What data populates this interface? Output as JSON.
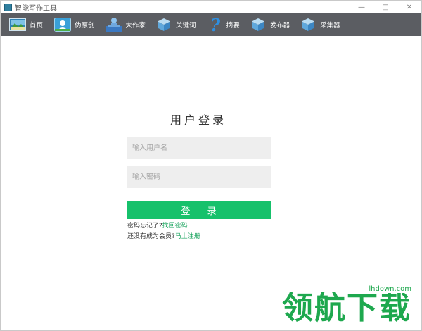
{
  "window": {
    "title": "智能写作工具",
    "controls": [
      "—",
      "□",
      "✕"
    ]
  },
  "toolbar": {
    "items": [
      {
        "label": "首页",
        "icon": "home-landscape-icon"
      },
      {
        "label": "伪原创",
        "icon": "user-card-icon"
      },
      {
        "label": "大作家",
        "icon": "writer-books-icon"
      },
      {
        "label": "关键词",
        "icon": "cube-icon"
      },
      {
        "label": "摘要",
        "icon": "question-mark-icon"
      },
      {
        "label": "发布器",
        "icon": "cube-icon"
      },
      {
        "label": "采集器",
        "icon": "cube-icon"
      }
    ]
  },
  "login": {
    "title": "用户登录",
    "username_placeholder": "输入用户名",
    "password_placeholder": "输入密码",
    "submit_label": "登 录",
    "forgot_text": "密码忘记了?",
    "forgot_link": "找回密码",
    "register_text": "还没有成为会员?",
    "register_link": "马上注册"
  },
  "watermark": {
    "text": "领航下载",
    "domain": "lhdown.com"
  },
  "colors": {
    "toolbar_bg": "#5b5d62",
    "accent_green": "#16c16b",
    "link_green": "#17a35c",
    "field_bg": "#eeeeee"
  }
}
